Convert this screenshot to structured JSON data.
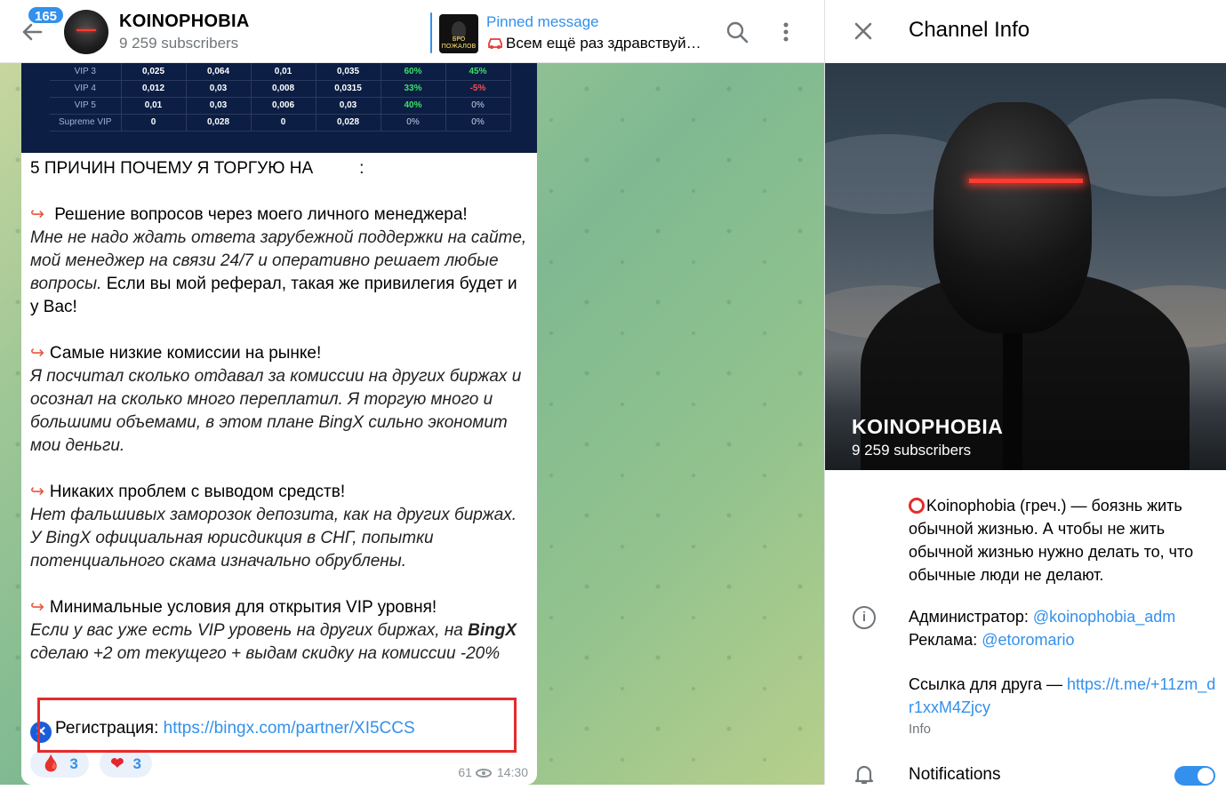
{
  "header": {
    "unread_count": "165",
    "channel_name": "KOINOPHOBIA",
    "subscribers": "9 259 subscribers",
    "pinned_label": "Pinned message",
    "pinned_text": "Всем ещё раз здравствуй…",
    "pinned_thumb_text": "БРО ПОЖАЛОВ"
  },
  "tier_table": {
    "rows": [
      {
        "tier": "VIP 3",
        "c1": "0,025",
        "c2": "0,064",
        "c3": "0,01",
        "c4": "0,035",
        "c5": "60%",
        "c6": "45%"
      },
      {
        "tier": "VIP 4",
        "c1": "0,012",
        "c2": "0,03",
        "c3": "0,008",
        "c4": "0,0315",
        "c5": "33%",
        "c6": "-5%"
      },
      {
        "tier": "VIP 5",
        "c1": "0,01",
        "c2": "0,03",
        "c3": "0,006",
        "c4": "0,03",
        "c5": "40%",
        "c6": "0%"
      },
      {
        "tier": "Supreme VIP",
        "c1": "0",
        "c2": "0,028",
        "c3": "0",
        "c4": "0,028",
        "c5": "0%",
        "c6": "0%"
      }
    ]
  },
  "message": {
    "headline": "5 ПРИЧИН ПОЧЕМУ Я ТОРГУЮ НА",
    "headline_suffix": ":",
    "r1_title": "Решение вопросов через моего личного менеджера!",
    "r1_body_italic": "Мне не надо ждать ответа зарубежной поддержки на сайте, мой менеджер на связи 24/7 и оперативно решает любые вопросы.",
    "r1_body_plain": " Если вы мой реферал, такая же привилегия будет и у Вас!",
    "r2_title": "Самые низкие комиссии на рынке!",
    "r2_body": "Я посчитал сколько отдавал за комиссии на других биржах и осознал на сколько много переплатил. Я торгую много и большими объемами, в этом плане BingX сильно экономит мои деньги.",
    "r3_title": "Никаких проблем с выводом средств!",
    "r3_body": "Нет фальшивых заморозок депозита, как на других биржах. У BingX официальная юрисдикция в СНГ, попытки потенциального скама изначально обрублены.",
    "r4_title": "Минимальные условия для открытия VIP уровня!",
    "r4_body_pre": "Если у вас уже есть VIP уровень на других биржах, на ",
    "r4_body_bold": "BingX",
    "r4_body_post": " сделаю +2 от текущего + выдам скидку на комиссии -20%",
    "reg_label": "Регистрация: ",
    "reg_link": "https://bingx.com/partner/XI5CCS",
    "reaction_fire_count": "3",
    "reaction_heart_count": "3",
    "views": "61",
    "time": "14:30"
  },
  "info": {
    "title": "Channel Info",
    "name": "KOINOPHOBIA",
    "subscribers": "9 259 subscribers",
    "description": "Koinophobia (греч.) — боязнь жить обычной жизнью. А чтобы не жить обычной жизнью нужно делать то, что обычные люди не делают.",
    "admin_label": "Администратор: ",
    "admin_handle": "@koinophobia_adm",
    "ads_label": "Реклама: ",
    "ads_handle": "@etoromario",
    "friend_label": "Ссылка для друга — ",
    "friend_link": "https://t.me/+11zm_dr1xxM4Zjcy",
    "info_caption": "Info",
    "notifications_label": "Notifications",
    "notifications_on": true
  },
  "colors": {
    "accent": "#3390ec",
    "highlight_box": "#e52b2b",
    "arrow": "#e8553b"
  }
}
